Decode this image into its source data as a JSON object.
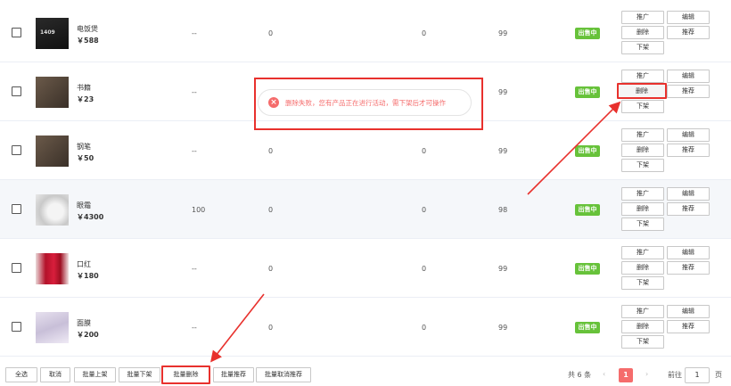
{
  "products": [
    {
      "name": "电饭煲",
      "price": "￥588",
      "col1": "--",
      "col2": "0",
      "col3": "0",
      "col4": "99",
      "status": "出售中",
      "thumb": "rice-cooker-image"
    },
    {
      "name": "书籍",
      "price": "￥23",
      "col1": "--",
      "col2": "0",
      "col3": "0",
      "col4": "99",
      "status": "出售中",
      "thumb": "book-image"
    },
    {
      "name": "钢笔",
      "price": "￥50",
      "col1": "--",
      "col2": "0",
      "col3": "0",
      "col4": "99",
      "status": "出售中",
      "thumb": "pen-image"
    },
    {
      "name": "眼霜",
      "price": "￥4300",
      "col1": "100",
      "col2": "0",
      "col3": "0",
      "col4": "98",
      "status": "出售中",
      "thumb": "eye-cream-image"
    },
    {
      "name": "口红",
      "price": "￥180",
      "col1": "--",
      "col2": "0",
      "col3": "0",
      "col4": "99",
      "status": "出售中",
      "thumb": "lipstick-image"
    },
    {
      "name": "面膜",
      "price": "￥200",
      "col1": "--",
      "col2": "0",
      "col3": "0",
      "col4": "99",
      "status": "出售中",
      "thumb": "face-mask-image"
    }
  ],
  "actions": {
    "promote": "推广",
    "edit": "编辑",
    "delete": "删除",
    "recommend": "推荐",
    "offshelf": "下架"
  },
  "toast": {
    "message": "删除失败，您有产品正在进行活动，需下架后才可操作"
  },
  "footer": {
    "buttons": [
      "全选",
      "取消",
      "批量上架",
      "批量下架",
      "批量删除",
      "批量推荐",
      "批量取消推荐"
    ],
    "total": "共 6 条",
    "current_page": "1",
    "goto_label": "前往",
    "goto_value": "1",
    "page_suffix": "页",
    "prev": "‹",
    "next": "›"
  },
  "colors": {
    "accent_red": "#e8312d",
    "badge_green": "#67c23a",
    "toast_red": "#f56c6c",
    "row_highlight": "#f5f7fa"
  }
}
